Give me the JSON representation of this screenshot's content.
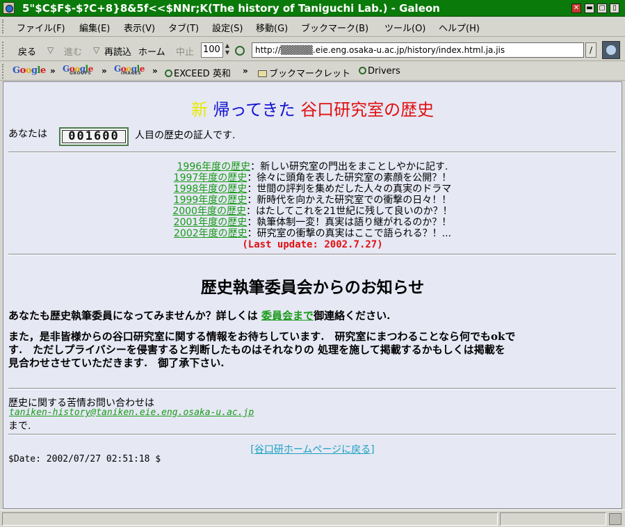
{
  "window": {
    "title": "5\"$C$F$-$?C+8}8&5f<<$NNr;K(The history of Taniguchi Lab.) - Galeon"
  },
  "menu": {
    "items": [
      "ファイル(F)",
      "編集(E)",
      "表示(V)",
      "タブ(T)",
      "設定(S)",
      "移動(G)",
      "ブックマーク(B)",
      "ツール(O)",
      "ヘルプ(H)"
    ]
  },
  "toolbar": {
    "back": "戻る",
    "forward": "進む",
    "reload": "再読込",
    "home": "ホーム",
    "stop": "中止",
    "zoom": "100",
    "url": "http://▒▒▒▒▒.eie.eng.osaka-u.ac.jp/history/index.html.ja.jis",
    "go": "/"
  },
  "bookmarks": {
    "google": "Google",
    "google_groups": "Google",
    "google_groups_sub": "GROUPS",
    "google_images": "Google",
    "google_images_sub": "IMAGES",
    "exceed": "EXCEED 英和",
    "bookmarklet": "ブックマークレット",
    "drivers": "Drivers",
    "arrow": "»"
  },
  "page": {
    "heading_new": "新",
    "heading_returned": "帰ってきた",
    "heading_lab": "谷口研究室の歴史",
    "visitor_prefix": "あなたは",
    "counter": "001600",
    "visitor_suffix": "人目の歴史の証人です.",
    "history": [
      {
        "link": "1996年度の歴史",
        "desc": "：新しい研究室の門出をまことしやかに記す."
      },
      {
        "link": "1997年度の歴史",
        "desc": "：徐々に頭角を表した研究室の素顔を公開？！"
      },
      {
        "link": "1998年度の歴史",
        "desc": "：世間の評判を集めだした人々の真実のドラマ"
      },
      {
        "link": "1999年度の歴史",
        "desc": "：新時代を向かえた研究室での衝撃の日々！！"
      },
      {
        "link": "2000年度の歴史",
        "desc": "：はたしてこれを21世紀に残して良いのか？！"
      },
      {
        "link": "2001年度の歴史",
        "desc": "：執筆体制一変！真実は語り継がれるのか？！"
      },
      {
        "link": "2002年度の歴史",
        "desc": "：研究室の衝撃の真実はここで語られる？！..."
      }
    ],
    "last_update": "(Last update: 2002.7.27)",
    "notice_title": "歴史執筆委員会からのお知らせ",
    "invite_prefix": "あなたも歴史執筆委員になってみませんか？詳しくは",
    "invite_link": "委員会まで",
    "invite_suffix": "御連絡ください.",
    "para_line1": "また，是非皆様からの谷口研究室に関する情報をお待ちしています.　研究室にまつわることなら何でもokで",
    "para_line2": "す.　ただしプライバシーを侵害すると判断したものはそれなりの 処理を施して掲載するかもしくは掲載を",
    "para_line3": "見合わせさせていただきます.　御了承下さい.",
    "contact_label": "歴史に関する苦情お問い合わせは",
    "contact_email": "taniken-history@taniken.eie.eng.osaka-u.ac.jp",
    "contact_suffix": "まで.",
    "home_link": "[谷口研ホームページに戻る]",
    "date": "$Date: 2002/07/27 02:51:18 $"
  },
  "colors": {
    "titlebar": "#0a7a0a",
    "link_green": "#1a9a1a",
    "heading_new": "#e8e800",
    "heading_returned": "#1010d0",
    "heading_lab": "#e01010",
    "last_update": "#e01010",
    "page_bg": "#e6e8f4"
  }
}
